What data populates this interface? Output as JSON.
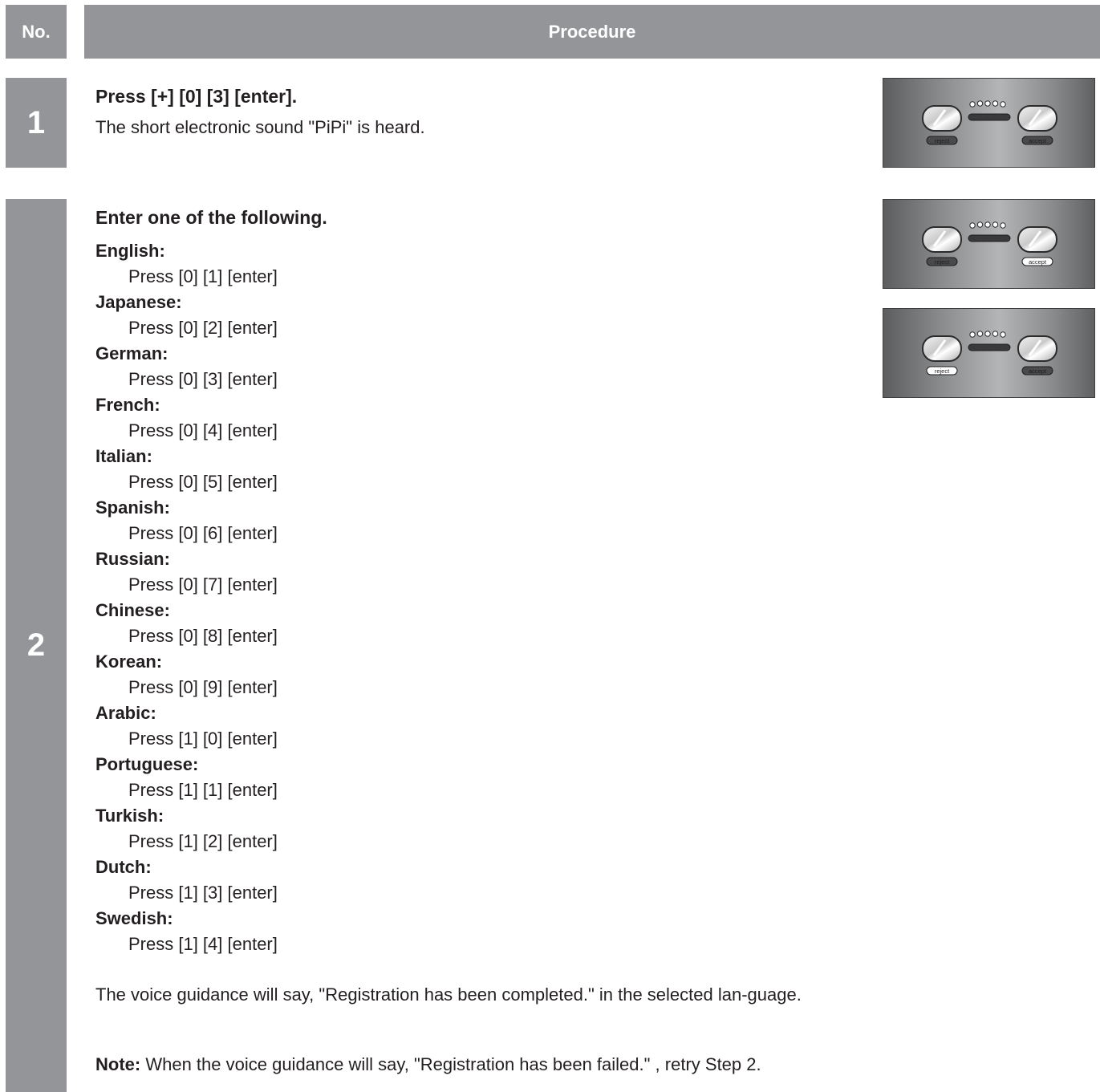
{
  "header": {
    "no_label": "No.",
    "procedure_label": "Procedure"
  },
  "steps": [
    {
      "number": "1",
      "title": "Press [+] [0] [3] [enter].",
      "description": "The short electronic sound \"PiPi\" is heard."
    },
    {
      "number": "2",
      "title": "Enter one of the following.",
      "languages": [
        {
          "name": "English:",
          "command": "Press [0] [1] [enter]"
        },
        {
          "name": "Japanese:",
          "command": "Press [0] [2] [enter]"
        },
        {
          "name": "German:",
          "command": "Press [0] [3] [enter]"
        },
        {
          "name": "French:",
          "command": "Press [0] [4] [enter]"
        },
        {
          "name": "Italian:",
          "command": "Press [0] [5] [enter]"
        },
        {
          "name": "Spanish:",
          "command": "Press [0] [6] [enter]"
        },
        {
          "name": "Russian:",
          "command": "Press [0] [7] [enter]"
        },
        {
          "name": "Chinese:",
          "command": "Press [0] [8] [enter]"
        },
        {
          "name": "Korean:",
          "command": "Press [0] [9] [enter]"
        },
        {
          "name": "Arabic:",
          "command": "Press [1] [0] [enter]"
        },
        {
          "name": "Portuguese:",
          "command": "Press [1] [1] [enter]"
        },
        {
          "name": "Turkish:",
          "command": "Press [1] [2] [enter]"
        },
        {
          "name": "Dutch:",
          "command": "Press [1] [3] [enter]"
        },
        {
          "name": "Swedish:",
          "command": "Press [1] [4] [enter]"
        }
      ],
      "result": "The voice guidance will say, \"Registration has been completed.\" in the selected lan-guage.",
      "note_label": "Note:",
      "note_text": " When the voice guidance will say, \"Registration has been failed.\" , retry Step 2."
    }
  ],
  "panels": [
    {
      "reject_label": "reject",
      "accept_label": "accept",
      "lit": "none"
    },
    {
      "reject_label": "reject",
      "accept_label": "accept",
      "lit": "accept"
    },
    {
      "reject_label": "reject",
      "accept_label": "accept",
      "lit": "reject"
    }
  ]
}
